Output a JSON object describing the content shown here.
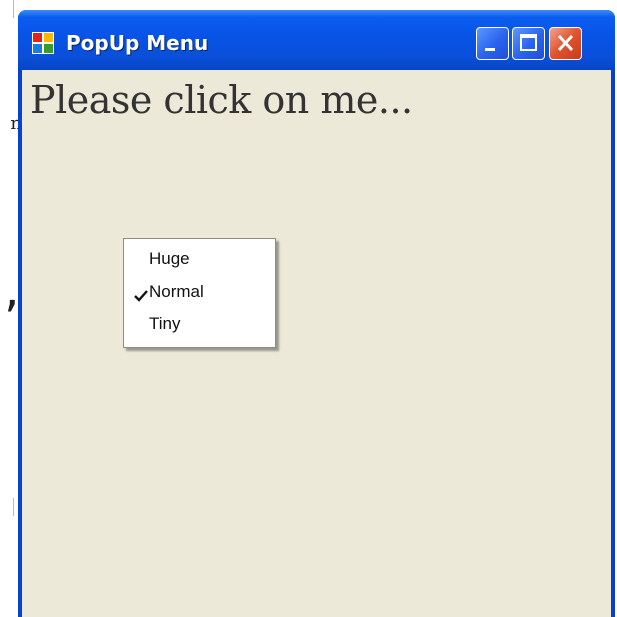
{
  "background": {
    "fragment_n": "n",
    "fragment_comma": ","
  },
  "window": {
    "title": "PopUp Menu",
    "buttons": {
      "minimize": "minimize-icon",
      "maximize": "maximize-icon",
      "close": "close-icon"
    },
    "colors": {
      "titlebar": "#0753e6",
      "client": "#ece9d8",
      "close_button": "#e0532e"
    }
  },
  "content": {
    "label": "Please click on me..."
  },
  "popup_menu": {
    "items": [
      {
        "label": "Huge",
        "checked": false
      },
      {
        "label": "Normal",
        "checked": true
      },
      {
        "label": "Tiny",
        "checked": false
      }
    ]
  }
}
